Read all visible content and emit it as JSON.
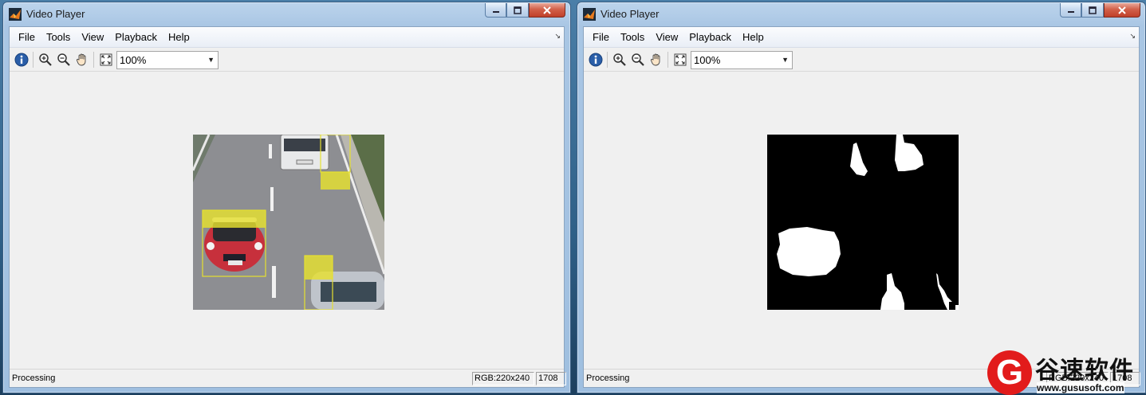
{
  "left_window": {
    "title": "Video Player",
    "menu": [
      "File",
      "Tools",
      "View",
      "Playback",
      "Help"
    ],
    "zoom": "100%",
    "status": "Processing",
    "resolution": "RGB:220x240",
    "frame": "1708",
    "frame_content": "color traffic frame with yellow detection boxes"
  },
  "right_window": {
    "title": "Video Player",
    "menu": [
      "File",
      "Tools",
      "View",
      "Playback",
      "Help"
    ],
    "zoom": "100%",
    "status": "Processing",
    "resolution": "RGB:220x240",
    "frame": "1708",
    "frame_content": "binary foreground mask"
  },
  "icons": {
    "info": "info-icon",
    "zoom_in": "zoom-in-icon",
    "zoom_out": "zoom-out-icon",
    "pan": "pan-hand-icon",
    "fit": "fit-to-window-icon"
  },
  "colors": {
    "detection_box": "#e6e030",
    "mask_fg": "#ffffff",
    "mask_bg": "#000000"
  },
  "watermark": {
    "logo_letter": "G",
    "name": "谷速软件",
    "url": "www.gususoft.com"
  }
}
